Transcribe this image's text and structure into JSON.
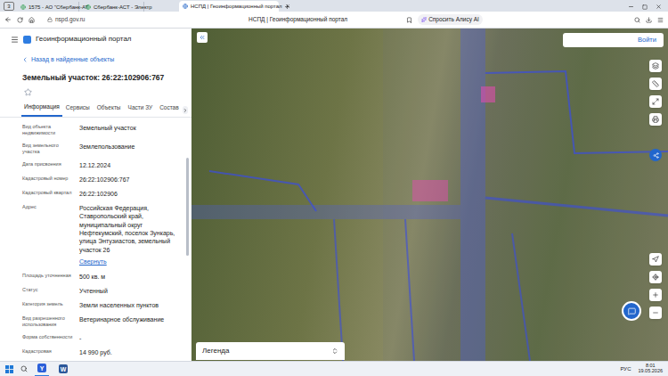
{
  "browser": {
    "tab_count": "3",
    "tabs": [
      {
        "label": "1575 - АО \"Сбербанк-АТ",
        "selected": false
      },
      {
        "label": "Сбербанк-АСТ - Электр",
        "selected": false
      },
      {
        "label": "НСПД | Геоинформационный портал",
        "selected": true
      }
    ],
    "address": "nspd.gov.ru",
    "page_title": "НСПД | Геоинформационный портал",
    "assistant": "Спросить Алису AI"
  },
  "panel": {
    "portal": "Геоинформационный портал",
    "back": "Назад в найденные объекты",
    "title": "Земельный участок: 26:22:102906:767",
    "favorite": false,
    "tabs": [
      {
        "label": "Информация",
        "selected": true
      },
      {
        "label": "Сервисы",
        "selected": false
      },
      {
        "label": "Объекты",
        "selected": false
      },
      {
        "label": "Части ЗУ",
        "selected": false
      },
      {
        "label": "Состав",
        "selected": false
      }
    ],
    "fields": [
      {
        "label": "Вид объекта недвижимости",
        "value": "Земельный участок"
      },
      {
        "label": "Вид земельного участка",
        "value": "Землепользование"
      },
      {
        "label": "Дата присвоения",
        "value": "12.12.2024"
      },
      {
        "label": "Кадастровый номер",
        "value": "26:22:102906:767"
      },
      {
        "label": "Кадастровый квартал",
        "value": "26:22:102906"
      },
      {
        "label": "Адрес",
        "value": "Российская Федерация, Ставропольский край, муниципальный округ Нефтекумский, поселок Зункарь, улица Энтузиастов, земельный участок 26",
        "link": "Свернуть"
      },
      {
        "label": "Площадь уточненная",
        "value": "500 кв. м"
      },
      {
        "label": "Статус",
        "value": "Учтенный"
      },
      {
        "label": "Категория земель",
        "value": "Земли населенных пунктов"
      },
      {
        "label": "Вид разрешенного использования",
        "value": "Ветеринарное обслуживание"
      },
      {
        "label": "Форма собственности",
        "value": "-"
      },
      {
        "label": "Кадастровая",
        "value": "14 990 руб."
      }
    ]
  },
  "map": {
    "login": "Войти",
    "legend": "Легенда"
  },
  "taskbar": {
    "apps": [
      {
        "glyph": "Y",
        "color": "#2b5fd9",
        "selected": true
      },
      {
        "glyph": "W",
        "color": "#2b579a",
        "selected": false
      }
    ],
    "language": "РУС",
    "time": "8:01",
    "date": "19.05.2026"
  }
}
